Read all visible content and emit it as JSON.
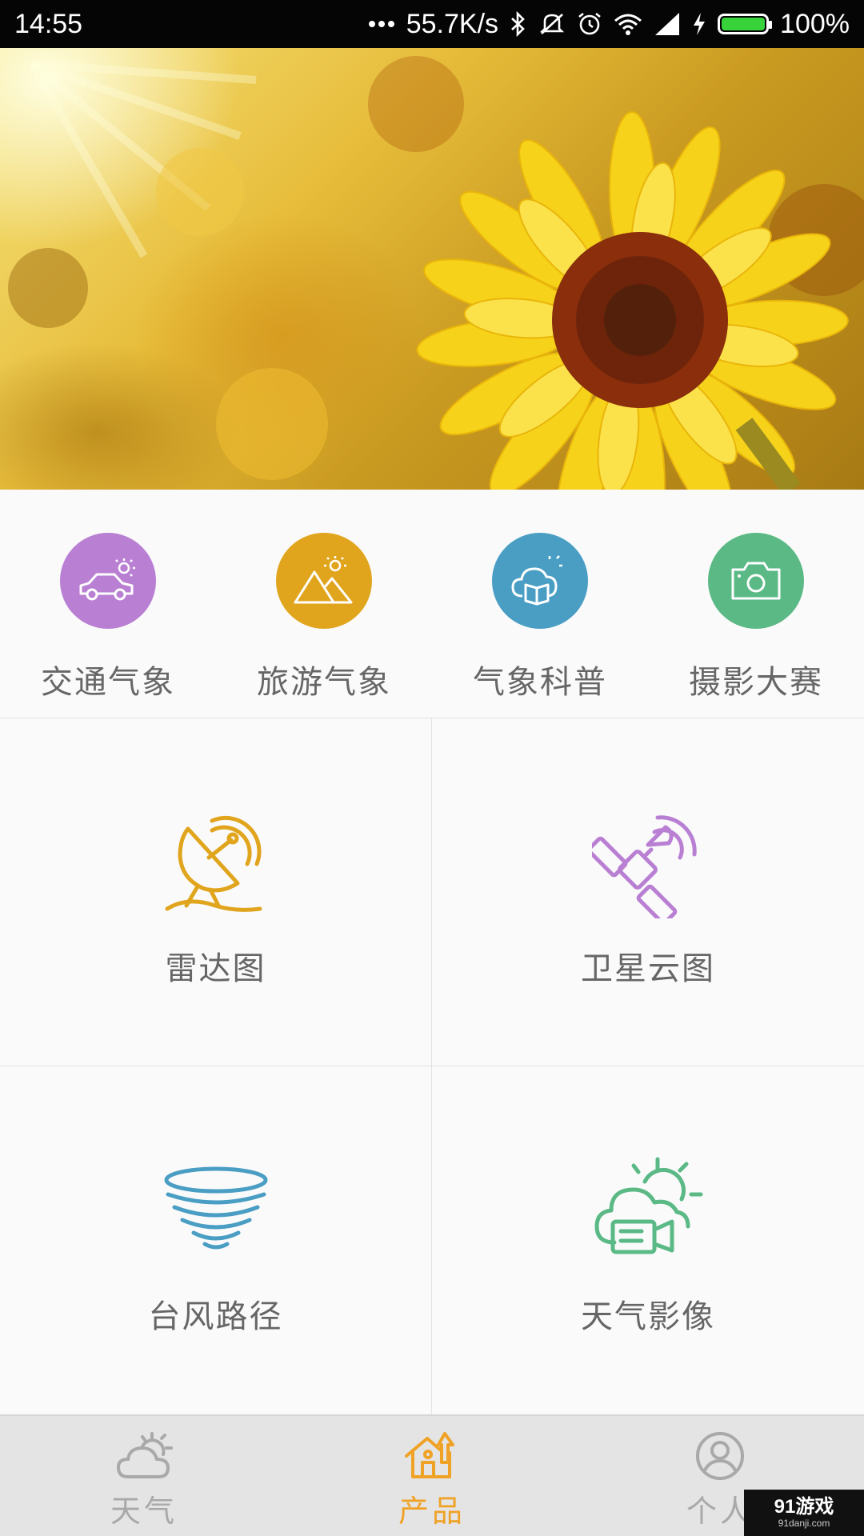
{
  "status_bar": {
    "time": "14:55",
    "network_speed": "55.7K/s",
    "battery_percent": "100%",
    "battery_level": 1.0,
    "icons": [
      "more-dots-icon",
      "bluetooth-icon",
      "silent-icon",
      "alarm-icon",
      "wifi-icon",
      "signal-icon",
      "charging-icon",
      "battery-icon"
    ]
  },
  "banner": {
    "image": "sunflower-photo"
  },
  "quick_items": [
    {
      "label": "交通气象",
      "icon": "car-sun-icon",
      "color": "#b97fd3"
    },
    {
      "label": "旅游气象",
      "icon": "mountain-sun-icon",
      "color": "#e0a51d"
    },
    {
      "label": "气象科普",
      "icon": "cloud-book-icon",
      "color": "#4a9ec4"
    },
    {
      "label": "摄影大赛",
      "icon": "camera-icon",
      "color": "#5bb986"
    }
  ],
  "grid_items": [
    {
      "label": "雷达图",
      "icon": "radar-dish-icon",
      "color": "#e0a51d"
    },
    {
      "label": "卫星云图",
      "icon": "satellite-icon",
      "color": "#b97fd3"
    },
    {
      "label": "台风路径",
      "icon": "typhoon-icon",
      "color": "#4a9ec4"
    },
    {
      "label": "天气影像",
      "icon": "cloud-camera-icon",
      "color": "#5bb986"
    }
  ],
  "bottom_nav": [
    {
      "label": "天气",
      "icon": "weather-icon",
      "active": false
    },
    {
      "label": "产品",
      "icon": "product-home-icon",
      "active": true
    },
    {
      "label": "个人",
      "icon": "person-icon",
      "active": false
    }
  ],
  "colors": {
    "active": "#f0a226",
    "inactive": "#a9a9a9"
  },
  "watermark": {
    "main": "91游戏",
    "sub": "91danji.com"
  }
}
